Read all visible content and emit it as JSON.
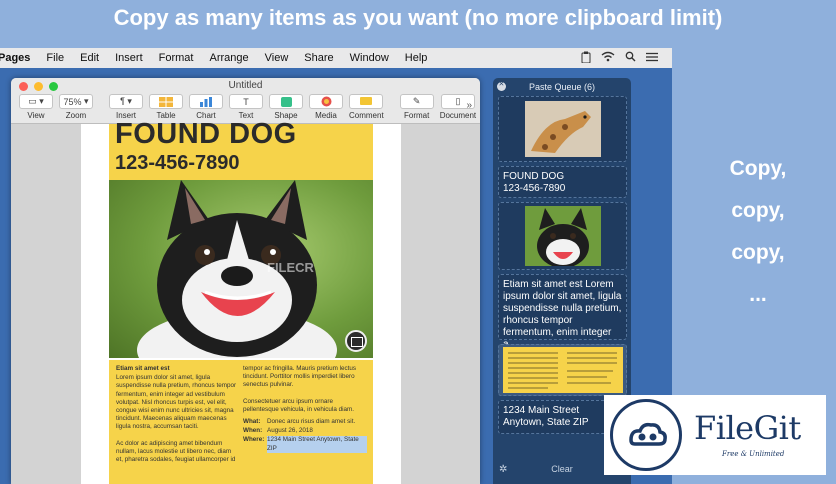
{
  "banner": "Copy as many items as you want (no more clipboard limit)",
  "menubar": {
    "app": "Pages",
    "items": [
      "File",
      "Edit",
      "Insert",
      "Format",
      "Arrange",
      "View",
      "Share",
      "Window",
      "Help"
    ],
    "status_icons": [
      "paste-queue-icon",
      "wifi-icon",
      "search-icon",
      "list-icon"
    ]
  },
  "pages_window": {
    "title": "Untitled",
    "toolbar": {
      "view": {
        "label": "View"
      },
      "zoom": {
        "value": "75%",
        "label": "Zoom"
      },
      "insert": {
        "label": "Insert"
      },
      "table": {
        "label": "Table"
      },
      "chart": {
        "label": "Chart"
      },
      "text": {
        "label": "Text"
      },
      "shape": {
        "label": "Shape"
      },
      "media": {
        "label": "Media"
      },
      "comment": {
        "label": "Comment"
      },
      "format": {
        "label": "Format"
      },
      "document": {
        "label": "Document"
      }
    },
    "poster": {
      "heading": "FOUND DOG",
      "phone": "123-456-7890",
      "watermark": "FILECR",
      "col1": {
        "title": "Etiam sit amet est",
        "para1": "Lorem ipsum dolor sit amet, ligula suspendisse nulla pretium, rhoncus tempor fermentum, enim integer ad vestibulum volutpat. Nisl rhoncus turpis est, vel elit, congue wisi enim nunc ultricies sit, magna tincidunt. Maecenas aliquam maecenas ligula nostra, accumsan taciti.",
        "para2": "Ac dolor ac adipiscing amet bibendum nullam, lacus molestie ut libero nec, diam et, pharetra sodales, feugiat ullamcorper id"
      },
      "col2": {
        "para1": "tempor ac fringilla. Mauris pretium lectus tincidunt. Porttitor mollis imperdiet libero senectus pulvinar.",
        "para2": "Consectetuer arcu ipsum ornare pellentesque vehicula, in vehicula diam.",
        "what_key": "What:",
        "what_val": "Donec arcu risus diam amet sit.",
        "when_key": "When:",
        "when_val": "August 26, 2018",
        "where_key": "Where:",
        "where_val": "1234 Main Street Anytown, State ZIP"
      }
    }
  },
  "paste_queue": {
    "title": "Paste Queue (6)",
    "items": [
      {
        "type": "image",
        "icon": "giraffe-image"
      },
      {
        "type": "text",
        "line1": "FOUND DOG",
        "line2": "123-456-7890"
      },
      {
        "type": "image",
        "icon": "dog-image"
      },
      {
        "type": "text",
        "text": "Etiam sit amet est Lorem ipsum dolor sit amet, ligula suspendisse nulla pretium, rhoncus tempor fermentum, enim integer a..."
      },
      {
        "type": "image",
        "icon": "poster-thumbnail"
      },
      {
        "type": "text",
        "line1": "1234 Main Street",
        "line2": "Anytown, State ZIP"
      }
    ],
    "clear_label": "Clear"
  },
  "side_text": [
    "Copy,",
    "copy,",
    "copy,",
    "..."
  ],
  "badge": {
    "name": "FileGit",
    "tagline": "Free & Unlimited"
  },
  "colors": {
    "banner_bg": "#8fb0dc",
    "desktop": "#3b6cb0",
    "poster_yellow": "#f6d34a",
    "queue_bg": "#24446c",
    "badge_blue": "#1d3a66"
  }
}
